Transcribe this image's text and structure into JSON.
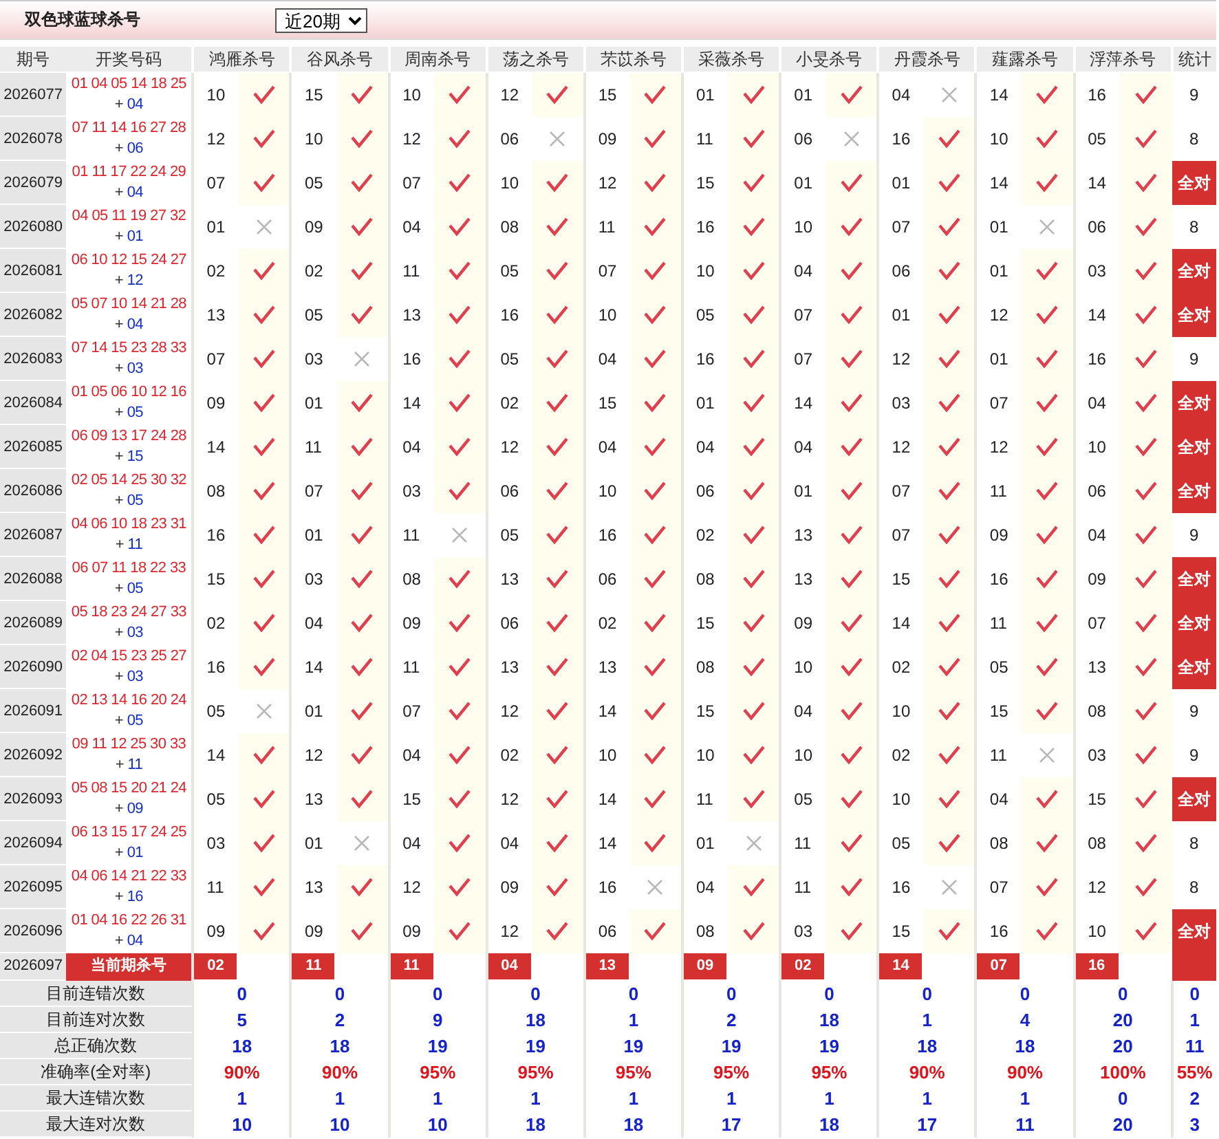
{
  "title": "双色球蓝球杀号",
  "period_select": {
    "value": "近20期"
  },
  "columns": [
    "期号",
    "开奖号码",
    "鸿雁杀号",
    "谷风杀号",
    "周南杀号",
    "荡之杀号",
    "芣苡杀号",
    "采薇杀号",
    "小旻杀号",
    "丹霞杀号",
    "薤露杀号",
    "浮萍杀号",
    "统计"
  ],
  "rows": [
    {
      "period": "2026077",
      "reds": "01 04 05 14 18 25",
      "blue": {
        "sign": "+",
        "number": "04"
      },
      "kills": [
        {
          "num": "10",
          "hit": true
        },
        {
          "num": "15",
          "hit": true
        },
        {
          "num": "10",
          "hit": true
        },
        {
          "num": "12",
          "hit": true
        },
        {
          "num": "15",
          "hit": true
        },
        {
          "num": "01",
          "hit": true
        },
        {
          "num": "01",
          "hit": true
        },
        {
          "num": "04",
          "hit": false
        },
        {
          "num": "14",
          "hit": true
        },
        {
          "num": "16",
          "hit": true
        }
      ],
      "stat": "9",
      "all_correct": false
    },
    {
      "period": "2026078",
      "reds": "07 11 14 16 27 28",
      "blue": {
        "sign": "+",
        "number": "06"
      },
      "kills": [
        {
          "num": "12",
          "hit": true
        },
        {
          "num": "10",
          "hit": true
        },
        {
          "num": "12",
          "hit": true
        },
        {
          "num": "06",
          "hit": false
        },
        {
          "num": "09",
          "hit": true
        },
        {
          "num": "11",
          "hit": true
        },
        {
          "num": "06",
          "hit": false
        },
        {
          "num": "16",
          "hit": true
        },
        {
          "num": "10",
          "hit": true
        },
        {
          "num": "05",
          "hit": true
        }
      ],
      "stat": "8",
      "all_correct": false
    },
    {
      "period": "2026079",
      "reds": "01 11 17 22 24 29",
      "blue": {
        "sign": "+",
        "number": "04"
      },
      "kills": [
        {
          "num": "07",
          "hit": true
        },
        {
          "num": "05",
          "hit": true
        },
        {
          "num": "07",
          "hit": true
        },
        {
          "num": "10",
          "hit": true
        },
        {
          "num": "12",
          "hit": true
        },
        {
          "num": "15",
          "hit": true
        },
        {
          "num": "01",
          "hit": true
        },
        {
          "num": "01",
          "hit": true
        },
        {
          "num": "14",
          "hit": true
        },
        {
          "num": "14",
          "hit": true
        }
      ],
      "stat": "全对",
      "all_correct": true
    },
    {
      "period": "2026080",
      "reds": "04 05 11 19 27 32",
      "blue": {
        "sign": "+",
        "number": "01"
      },
      "kills": [
        {
          "num": "01",
          "hit": false
        },
        {
          "num": "09",
          "hit": true
        },
        {
          "num": "04",
          "hit": true
        },
        {
          "num": "08",
          "hit": true
        },
        {
          "num": "11",
          "hit": true
        },
        {
          "num": "16",
          "hit": true
        },
        {
          "num": "10",
          "hit": true
        },
        {
          "num": "07",
          "hit": true
        },
        {
          "num": "01",
          "hit": false
        },
        {
          "num": "06",
          "hit": true
        }
      ],
      "stat": "8",
      "all_correct": false
    },
    {
      "period": "2026081",
      "reds": "06 10 12 15 24 27",
      "blue": {
        "sign": "+",
        "number": "12"
      },
      "kills": [
        {
          "num": "02",
          "hit": true
        },
        {
          "num": "02",
          "hit": true
        },
        {
          "num": "11",
          "hit": true
        },
        {
          "num": "05",
          "hit": true
        },
        {
          "num": "07",
          "hit": true
        },
        {
          "num": "10",
          "hit": true
        },
        {
          "num": "04",
          "hit": true
        },
        {
          "num": "06",
          "hit": true
        },
        {
          "num": "01",
          "hit": true
        },
        {
          "num": "03",
          "hit": true
        }
      ],
      "stat": "全对",
      "all_correct": true
    },
    {
      "period": "2026082",
      "reds": "05 07 10 14 21 28",
      "blue": {
        "sign": "+",
        "number": "04"
      },
      "kills": [
        {
          "num": "13",
          "hit": true
        },
        {
          "num": "05",
          "hit": true
        },
        {
          "num": "13",
          "hit": true
        },
        {
          "num": "16",
          "hit": true
        },
        {
          "num": "10",
          "hit": true
        },
        {
          "num": "05",
          "hit": true
        },
        {
          "num": "07",
          "hit": true
        },
        {
          "num": "01",
          "hit": true
        },
        {
          "num": "12",
          "hit": true
        },
        {
          "num": "14",
          "hit": true
        }
      ],
      "stat": "全对",
      "all_correct": true
    },
    {
      "period": "2026083",
      "reds": "07 14 15 23 28 33",
      "blue": {
        "sign": "+",
        "number": "03"
      },
      "kills": [
        {
          "num": "07",
          "hit": true
        },
        {
          "num": "03",
          "hit": false
        },
        {
          "num": "16",
          "hit": true
        },
        {
          "num": "05",
          "hit": true
        },
        {
          "num": "04",
          "hit": true
        },
        {
          "num": "16",
          "hit": true
        },
        {
          "num": "07",
          "hit": true
        },
        {
          "num": "12",
          "hit": true
        },
        {
          "num": "01",
          "hit": true
        },
        {
          "num": "16",
          "hit": true
        }
      ],
      "stat": "9",
      "all_correct": false
    },
    {
      "period": "2026084",
      "reds": "01 05 06 10 12 16",
      "blue": {
        "sign": "+",
        "number": "05"
      },
      "kills": [
        {
          "num": "09",
          "hit": true
        },
        {
          "num": "01",
          "hit": true
        },
        {
          "num": "14",
          "hit": true
        },
        {
          "num": "02",
          "hit": true
        },
        {
          "num": "15",
          "hit": true
        },
        {
          "num": "01",
          "hit": true
        },
        {
          "num": "14",
          "hit": true
        },
        {
          "num": "03",
          "hit": true
        },
        {
          "num": "07",
          "hit": true
        },
        {
          "num": "04",
          "hit": true
        }
      ],
      "stat": "全对",
      "all_correct": true
    },
    {
      "period": "2026085",
      "reds": "06 09 13 17 24 28",
      "blue": {
        "sign": "+",
        "number": "15"
      },
      "kills": [
        {
          "num": "14",
          "hit": true
        },
        {
          "num": "11",
          "hit": true
        },
        {
          "num": "04",
          "hit": true
        },
        {
          "num": "12",
          "hit": true
        },
        {
          "num": "04",
          "hit": true
        },
        {
          "num": "04",
          "hit": true
        },
        {
          "num": "04",
          "hit": true
        },
        {
          "num": "12",
          "hit": true
        },
        {
          "num": "12",
          "hit": true
        },
        {
          "num": "10",
          "hit": true
        }
      ],
      "stat": "全对",
      "all_correct": true
    },
    {
      "period": "2026086",
      "reds": "02 05 14 25 30 32",
      "blue": {
        "sign": "+",
        "number": "05"
      },
      "kills": [
        {
          "num": "08",
          "hit": true
        },
        {
          "num": "07",
          "hit": true
        },
        {
          "num": "03",
          "hit": true
        },
        {
          "num": "06",
          "hit": true
        },
        {
          "num": "10",
          "hit": true
        },
        {
          "num": "06",
          "hit": true
        },
        {
          "num": "01",
          "hit": true
        },
        {
          "num": "07",
          "hit": true
        },
        {
          "num": "11",
          "hit": true
        },
        {
          "num": "06",
          "hit": true
        }
      ],
      "stat": "全对",
      "all_correct": true
    },
    {
      "period": "2026087",
      "reds": "04 06 10 18 23 31",
      "blue": {
        "sign": "+",
        "number": "11"
      },
      "kills": [
        {
          "num": "16",
          "hit": true
        },
        {
          "num": "01",
          "hit": true
        },
        {
          "num": "11",
          "hit": false
        },
        {
          "num": "05",
          "hit": true
        },
        {
          "num": "16",
          "hit": true
        },
        {
          "num": "02",
          "hit": true
        },
        {
          "num": "13",
          "hit": true
        },
        {
          "num": "07",
          "hit": true
        },
        {
          "num": "09",
          "hit": true
        },
        {
          "num": "04",
          "hit": true
        }
      ],
      "stat": "9",
      "all_correct": false
    },
    {
      "period": "2026088",
      "reds": "06 07 11 18 22 33",
      "blue": {
        "sign": "+",
        "number": "05"
      },
      "kills": [
        {
          "num": "15",
          "hit": true
        },
        {
          "num": "03",
          "hit": true
        },
        {
          "num": "08",
          "hit": true
        },
        {
          "num": "13",
          "hit": true
        },
        {
          "num": "06",
          "hit": true
        },
        {
          "num": "08",
          "hit": true
        },
        {
          "num": "13",
          "hit": true
        },
        {
          "num": "15",
          "hit": true
        },
        {
          "num": "16",
          "hit": true
        },
        {
          "num": "09",
          "hit": true
        }
      ],
      "stat": "全对",
      "all_correct": true
    },
    {
      "period": "2026089",
      "reds": "05 18 23 24 27 33",
      "blue": {
        "sign": "+",
        "number": "03"
      },
      "kills": [
        {
          "num": "02",
          "hit": true
        },
        {
          "num": "04",
          "hit": true
        },
        {
          "num": "09",
          "hit": true
        },
        {
          "num": "06",
          "hit": true
        },
        {
          "num": "02",
          "hit": true
        },
        {
          "num": "15",
          "hit": true
        },
        {
          "num": "09",
          "hit": true
        },
        {
          "num": "14",
          "hit": true
        },
        {
          "num": "11",
          "hit": true
        },
        {
          "num": "07",
          "hit": true
        }
      ],
      "stat": "全对",
      "all_correct": true
    },
    {
      "period": "2026090",
      "reds": "02 04 15 23 25 27",
      "blue": {
        "sign": "+",
        "number": "03"
      },
      "kills": [
        {
          "num": "16",
          "hit": true
        },
        {
          "num": "14",
          "hit": true
        },
        {
          "num": "11",
          "hit": true
        },
        {
          "num": "13",
          "hit": true
        },
        {
          "num": "13",
          "hit": true
        },
        {
          "num": "08",
          "hit": true
        },
        {
          "num": "10",
          "hit": true
        },
        {
          "num": "02",
          "hit": true
        },
        {
          "num": "05",
          "hit": true
        },
        {
          "num": "13",
          "hit": true
        }
      ],
      "stat": "全对",
      "all_correct": true
    },
    {
      "period": "2026091",
      "reds": "02 13 14 16 20 24",
      "blue": {
        "sign": "+",
        "number": "05"
      },
      "kills": [
        {
          "num": "05",
          "hit": false
        },
        {
          "num": "01",
          "hit": true
        },
        {
          "num": "07",
          "hit": true
        },
        {
          "num": "12",
          "hit": true
        },
        {
          "num": "14",
          "hit": true
        },
        {
          "num": "15",
          "hit": true
        },
        {
          "num": "04",
          "hit": true
        },
        {
          "num": "10",
          "hit": true
        },
        {
          "num": "15",
          "hit": true
        },
        {
          "num": "08",
          "hit": true
        }
      ],
      "stat": "9",
      "all_correct": false
    },
    {
      "period": "2026092",
      "reds": "09 11 12 25 30 33",
      "blue": {
        "sign": "+",
        "number": "11"
      },
      "kills": [
        {
          "num": "14",
          "hit": true
        },
        {
          "num": "12",
          "hit": true
        },
        {
          "num": "04",
          "hit": true
        },
        {
          "num": "02",
          "hit": true
        },
        {
          "num": "10",
          "hit": true
        },
        {
          "num": "10",
          "hit": true
        },
        {
          "num": "10",
          "hit": true
        },
        {
          "num": "02",
          "hit": true
        },
        {
          "num": "11",
          "hit": false
        },
        {
          "num": "03",
          "hit": true
        }
      ],
      "stat": "9",
      "all_correct": false
    },
    {
      "period": "2026093",
      "reds": "05 08 15 20 21 24",
      "blue": {
        "sign": "+",
        "number": "09"
      },
      "kills": [
        {
          "num": "05",
          "hit": true
        },
        {
          "num": "13",
          "hit": true
        },
        {
          "num": "15",
          "hit": true
        },
        {
          "num": "12",
          "hit": true
        },
        {
          "num": "14",
          "hit": true
        },
        {
          "num": "11",
          "hit": true
        },
        {
          "num": "05",
          "hit": true
        },
        {
          "num": "10",
          "hit": true
        },
        {
          "num": "04",
          "hit": true
        },
        {
          "num": "15",
          "hit": true
        }
      ],
      "stat": "全对",
      "all_correct": true
    },
    {
      "period": "2026094",
      "reds": "06 13 15 17 24 25",
      "blue": {
        "sign": "+",
        "number": "01"
      },
      "kills": [
        {
          "num": "03",
          "hit": true
        },
        {
          "num": "01",
          "hit": false
        },
        {
          "num": "04",
          "hit": true
        },
        {
          "num": "04",
          "hit": true
        },
        {
          "num": "14",
          "hit": true
        },
        {
          "num": "01",
          "hit": false
        },
        {
          "num": "11",
          "hit": true
        },
        {
          "num": "05",
          "hit": true
        },
        {
          "num": "08",
          "hit": true
        },
        {
          "num": "08",
          "hit": true
        }
      ],
      "stat": "8",
      "all_correct": false
    },
    {
      "period": "2026095",
      "reds": "04 06 14 21 22 33",
      "blue": {
        "sign": "+",
        "number": "16"
      },
      "kills": [
        {
          "num": "11",
          "hit": true
        },
        {
          "num": "13",
          "hit": true
        },
        {
          "num": "12",
          "hit": true
        },
        {
          "num": "09",
          "hit": true
        },
        {
          "num": "16",
          "hit": false
        },
        {
          "num": "04",
          "hit": true
        },
        {
          "num": "11",
          "hit": true
        },
        {
          "num": "16",
          "hit": false
        },
        {
          "num": "07",
          "hit": true
        },
        {
          "num": "12",
          "hit": true
        }
      ],
      "stat": "8",
      "all_correct": false
    },
    {
      "period": "2026096",
      "reds": "01 04 16 22 26 31",
      "blue": {
        "sign": "+",
        "number": "04"
      },
      "kills": [
        {
          "num": "09",
          "hit": true
        },
        {
          "num": "09",
          "hit": true
        },
        {
          "num": "09",
          "hit": true
        },
        {
          "num": "12",
          "hit": true
        },
        {
          "num": "06",
          "hit": true
        },
        {
          "num": "08",
          "hit": true
        },
        {
          "num": "03",
          "hit": true
        },
        {
          "num": "15",
          "hit": true
        },
        {
          "num": "16",
          "hit": true
        },
        {
          "num": "10",
          "hit": true
        }
      ],
      "stat": "全对",
      "all_correct": true
    }
  ],
  "current": {
    "period": "2026097",
    "label": "当前期杀号",
    "kills": [
      "02",
      "11",
      "11",
      "04",
      "13",
      "09",
      "02",
      "14",
      "07",
      "16"
    ]
  },
  "summary": [
    {
      "label": "目前连错次数",
      "kind": "count",
      "values": [
        "0",
        "0",
        "0",
        "0",
        "0",
        "0",
        "0",
        "0",
        "0",
        "0",
        "0"
      ]
    },
    {
      "label": "目前连对次数",
      "kind": "count",
      "values": [
        "5",
        "2",
        "9",
        "18",
        "1",
        "2",
        "18",
        "1",
        "4",
        "20",
        "1"
      ]
    },
    {
      "label": "总正确次数",
      "kind": "count",
      "values": [
        "18",
        "18",
        "19",
        "19",
        "19",
        "19",
        "19",
        "18",
        "18",
        "20",
        "11"
      ]
    },
    {
      "label": "准确率(全对率)",
      "kind": "rate",
      "values": [
        "90%",
        "90%",
        "95%",
        "95%",
        "95%",
        "95%",
        "95%",
        "90%",
        "90%",
        "100%",
        "55%"
      ]
    },
    {
      "label": "最大连错次数",
      "kind": "count",
      "values": [
        "1",
        "1",
        "1",
        "1",
        "1",
        "1",
        "1",
        "1",
        "1",
        "0",
        "2"
      ]
    },
    {
      "label": "最大连对次数",
      "kind": "count",
      "values": [
        "10",
        "10",
        "10",
        "18",
        "18",
        "17",
        "18",
        "17",
        "11",
        "20",
        "3"
      ]
    }
  ]
}
